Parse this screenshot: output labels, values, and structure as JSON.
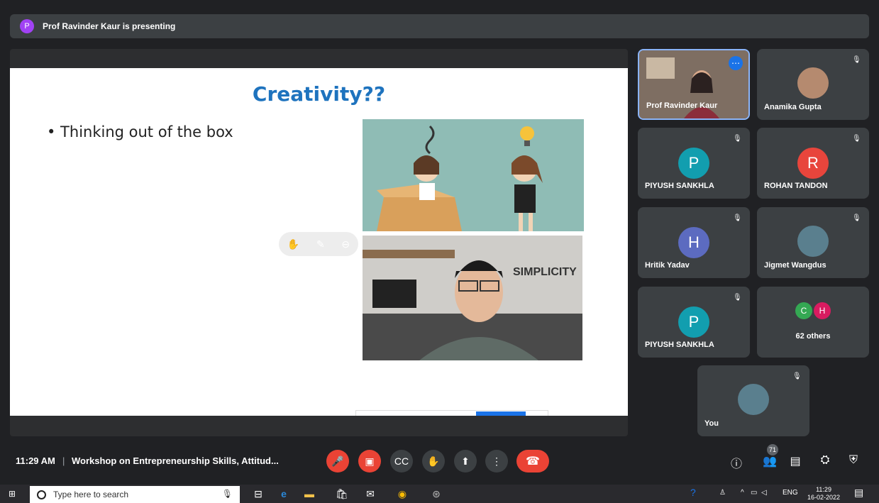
{
  "presenter_banner": {
    "avatar_letter": "P",
    "text": "Prof Ravinder Kaur is presenting"
  },
  "slide": {
    "title": "Creativity??",
    "bullet": "• Thinking out of the box",
    "video_caption": "SIMPLICITY"
  },
  "participants": [
    {
      "name": "Prof Ravinder Kaur",
      "type": "video",
      "presenting": true
    },
    {
      "name": "Anamika Gupta",
      "type": "photo",
      "muted": true
    },
    {
      "name": "PIYUSH SANKHLA",
      "type": "letter",
      "letter": "P",
      "color": "#129eaf",
      "muted": true
    },
    {
      "name": "ROHAN TANDON",
      "type": "letter",
      "letter": "R",
      "color": "#e8453c",
      "muted": true
    },
    {
      "name": "Hritik Yadav",
      "type": "letter",
      "letter": "H",
      "color": "#5c6bc0",
      "muted": true
    },
    {
      "name": "Jigmet Wangdus",
      "type": "photo",
      "muted": true
    },
    {
      "name": "PIYUSH SANKHLA",
      "type": "letter",
      "letter": "P",
      "color": "#129eaf",
      "muted": true
    },
    {
      "name": "62 others",
      "type": "group",
      "letters": [
        "C",
        "H"
      ],
      "colors": [
        "#34a853",
        "#d81b60"
      ]
    },
    {
      "name": "You",
      "type": "photo",
      "muted": true
    }
  ],
  "bottom_bar": {
    "time": "11:29 AM",
    "separator": "|",
    "meeting_title": "Workshop on Entrepreneurship Skills, Attitud...",
    "participant_count": "71"
  },
  "taskbar": {
    "search_placeholder": "Type here to search",
    "lang": "ENG",
    "clock_time": "11:29",
    "clock_date": "16-02-2022"
  },
  "colors": {
    "accent": "#1a73e8",
    "danger": "#ea4335",
    "title_blue": "#1e73be"
  }
}
